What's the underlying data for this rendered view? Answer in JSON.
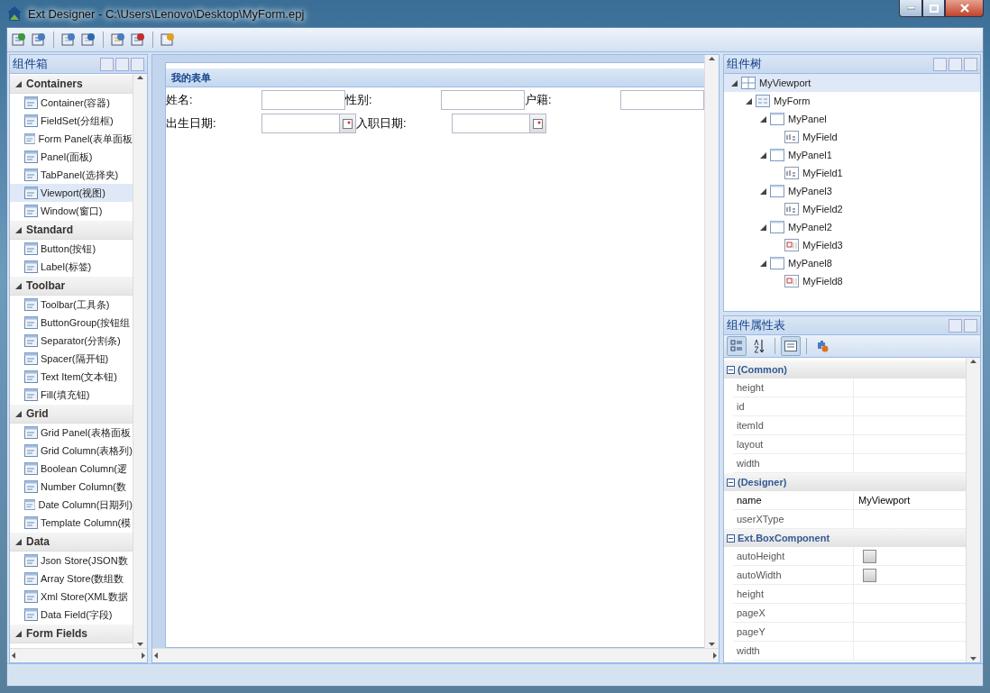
{
  "window": {
    "title": "Ext Designer - C:\\Users\\Lenovo\\Desktop\\MyForm.epj"
  },
  "toolbox": {
    "title": "组件箱",
    "groups": [
      {
        "label": "Containers",
        "expanded": true,
        "items": [
          {
            "label": "Container(容器)",
            "selected": false
          },
          {
            "label": "FieldSet(分组框)",
            "selected": false
          },
          {
            "label": "Form Panel(表单面板",
            "selected": false
          },
          {
            "label": "Panel(面板)",
            "selected": false
          },
          {
            "label": "TabPanel(选择夹)",
            "selected": false
          },
          {
            "label": "Viewport(视图)",
            "selected": true
          },
          {
            "label": "Window(窗口)",
            "selected": false
          }
        ]
      },
      {
        "label": "Standard",
        "expanded": true,
        "items": [
          {
            "label": "Button(按钮)",
            "selected": false
          },
          {
            "label": "Label(标签)",
            "selected": false
          }
        ]
      },
      {
        "label": "Toolbar",
        "expanded": true,
        "items": [
          {
            "label": "Toolbar(工具条)",
            "selected": false
          },
          {
            "label": "ButtonGroup(按钮组",
            "selected": false
          },
          {
            "label": "Separator(分割条)",
            "selected": false
          },
          {
            "label": "Spacer(隔开钮)",
            "selected": false
          },
          {
            "label": "Text Item(文本钮)",
            "selected": false
          },
          {
            "label": "Fill(填充钮)",
            "selected": false
          }
        ]
      },
      {
        "label": "Grid",
        "expanded": true,
        "items": [
          {
            "label": "Grid Panel(表格面板",
            "selected": false
          },
          {
            "label": "Grid Column(表格列)",
            "selected": false
          },
          {
            "label": "Boolean Column(逻",
            "selected": false
          },
          {
            "label": "Number Column(数",
            "selected": false
          },
          {
            "label": "Date Column(日期列)",
            "selected": false
          },
          {
            "label": "Template Column(模",
            "selected": false
          }
        ]
      },
      {
        "label": "Data",
        "expanded": true,
        "items": [
          {
            "label": "Json Store(JSON数",
            "selected": false
          },
          {
            "label": "Array Store(数组数",
            "selected": false
          },
          {
            "label": "Xml Store(XML数据",
            "selected": false
          },
          {
            "label": "Data Field(字段)",
            "selected": false
          }
        ]
      },
      {
        "label": "Form Fields",
        "expanded": true
      }
    ]
  },
  "form": {
    "title": "我的表单",
    "rows": [
      [
        {
          "label": "姓名:",
          "kind": "text"
        },
        {
          "label": "性别:",
          "kind": "text"
        },
        {
          "label": "户籍:",
          "kind": "text"
        }
      ],
      [
        {
          "label": "出生日期:",
          "kind": "date"
        },
        {
          "label": "入职日期:",
          "kind": "date"
        }
      ]
    ]
  },
  "tree": {
    "title": "组件树",
    "nodes": [
      {
        "label": "MyViewport",
        "kind": "viewport",
        "selected": true,
        "expanded": true,
        "children": [
          {
            "label": "MyForm",
            "kind": "form",
            "selected": false,
            "expanded": true,
            "children": [
              {
                "label": "MyPanel",
                "kind": "panel",
                "selected": false,
                "expanded": true,
                "children": [
                  {
                    "label": "MyField",
                    "kind": "text",
                    "selected": false
                  }
                ]
              },
              {
                "label": "MyPanel1",
                "kind": "panel",
                "selected": false,
                "expanded": true,
                "children": [
                  {
                    "label": "MyField1",
                    "kind": "text",
                    "selected": false
                  }
                ]
              },
              {
                "label": "MyPanel3",
                "kind": "panel",
                "selected": false,
                "expanded": true,
                "children": [
                  {
                    "label": "MyField2",
                    "kind": "text",
                    "selected": false
                  }
                ]
              },
              {
                "label": "MyPanel2",
                "kind": "panel",
                "selected": false,
                "expanded": true,
                "children": [
                  {
                    "label": "MyField3",
                    "kind": "date",
                    "selected": false
                  }
                ]
              },
              {
                "label": "MyPanel8",
                "kind": "panel",
                "selected": false,
                "expanded": true,
                "children": [
                  {
                    "label": "MyField8",
                    "kind": "date",
                    "selected": false
                  }
                ]
              }
            ]
          }
        ]
      }
    ]
  },
  "properties": {
    "title": "组件属性表",
    "groups": [
      {
        "label": "(Common)",
        "expanded": true,
        "rows": [
          {
            "name": "height",
            "kind": "text"
          },
          {
            "name": "id",
            "kind": "text"
          },
          {
            "name": "itemId",
            "kind": "text"
          },
          {
            "name": "layout",
            "kind": "text"
          },
          {
            "name": "width",
            "kind": "text"
          }
        ]
      },
      {
        "label": "(Designer)",
        "expanded": true,
        "rows": [
          {
            "name": "name",
            "kind": "text",
            "value": "MyViewport"
          },
          {
            "name": "userXType",
            "kind": "text"
          }
        ]
      },
      {
        "label": "Ext.BoxComponent",
        "expanded": true,
        "rows": [
          {
            "name": "autoHeight",
            "kind": "checkbox",
            "checked": false
          },
          {
            "name": "autoWidth",
            "kind": "checkbox",
            "checked": false
          },
          {
            "name": "height",
            "kind": "text"
          },
          {
            "name": "pageX",
            "kind": "text"
          },
          {
            "name": "pageY",
            "kind": "text"
          },
          {
            "name": "width",
            "kind": "text"
          }
        ]
      }
    ]
  }
}
